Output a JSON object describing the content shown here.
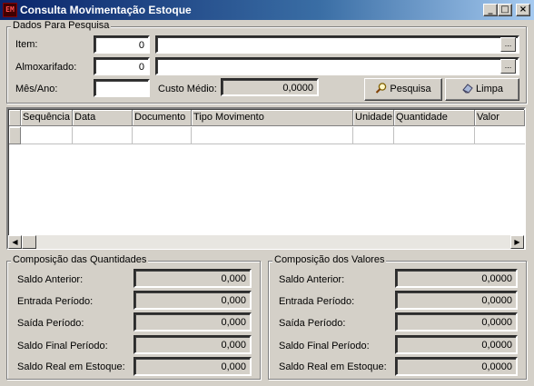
{
  "window": {
    "title": "Consulta Movimentação Estoque",
    "icon_text": "EM",
    "minimize": "_",
    "maximize": "□",
    "close": "×"
  },
  "search": {
    "legend": "Dados Para Pesquisa",
    "item_label": "Item:",
    "item_value": "0",
    "item_desc": "",
    "almox_label": "Almoxarifado:",
    "almox_value": "0",
    "almox_desc": "",
    "mesano_label": "Mês/Ano:",
    "mesano_value": "",
    "custo_label": "Custo Médio:",
    "custo_value": "0,0000",
    "ellipsis": "...",
    "pesquisa_button": "Pesquisa",
    "limpa_button": "Limpa"
  },
  "grid": {
    "columns": [
      "Sequência",
      "Data",
      "Documento",
      "Tipo Movimento",
      "Unidade",
      "Quantidade",
      "Valor"
    ]
  },
  "quantidades": {
    "legend": "Composição das Quantidades",
    "rows": [
      {
        "label": "Saldo Anterior:",
        "value": "0,000"
      },
      {
        "label": "Entrada Período:",
        "value": "0,000"
      },
      {
        "label": "Saída Período:",
        "value": "0,000"
      },
      {
        "label": "Saldo Final Período:",
        "value": "0,000"
      },
      {
        "label": "Saldo Real em Estoque:",
        "value": "0,000"
      }
    ]
  },
  "valores": {
    "legend": "Composição dos Valores",
    "rows": [
      {
        "label": "Saldo Anterior:",
        "value": "0,0000"
      },
      {
        "label": "Entrada Período:",
        "value": "0,0000"
      },
      {
        "label": "Saída Período:",
        "value": "0,0000"
      },
      {
        "label": "Saldo Final Período:",
        "value": "0,0000"
      },
      {
        "label": "Saldo Real em Estoque:",
        "value": "0,0000"
      }
    ]
  },
  "scrollbar": {
    "left_arrow": "◀",
    "right_arrow": "▶"
  }
}
